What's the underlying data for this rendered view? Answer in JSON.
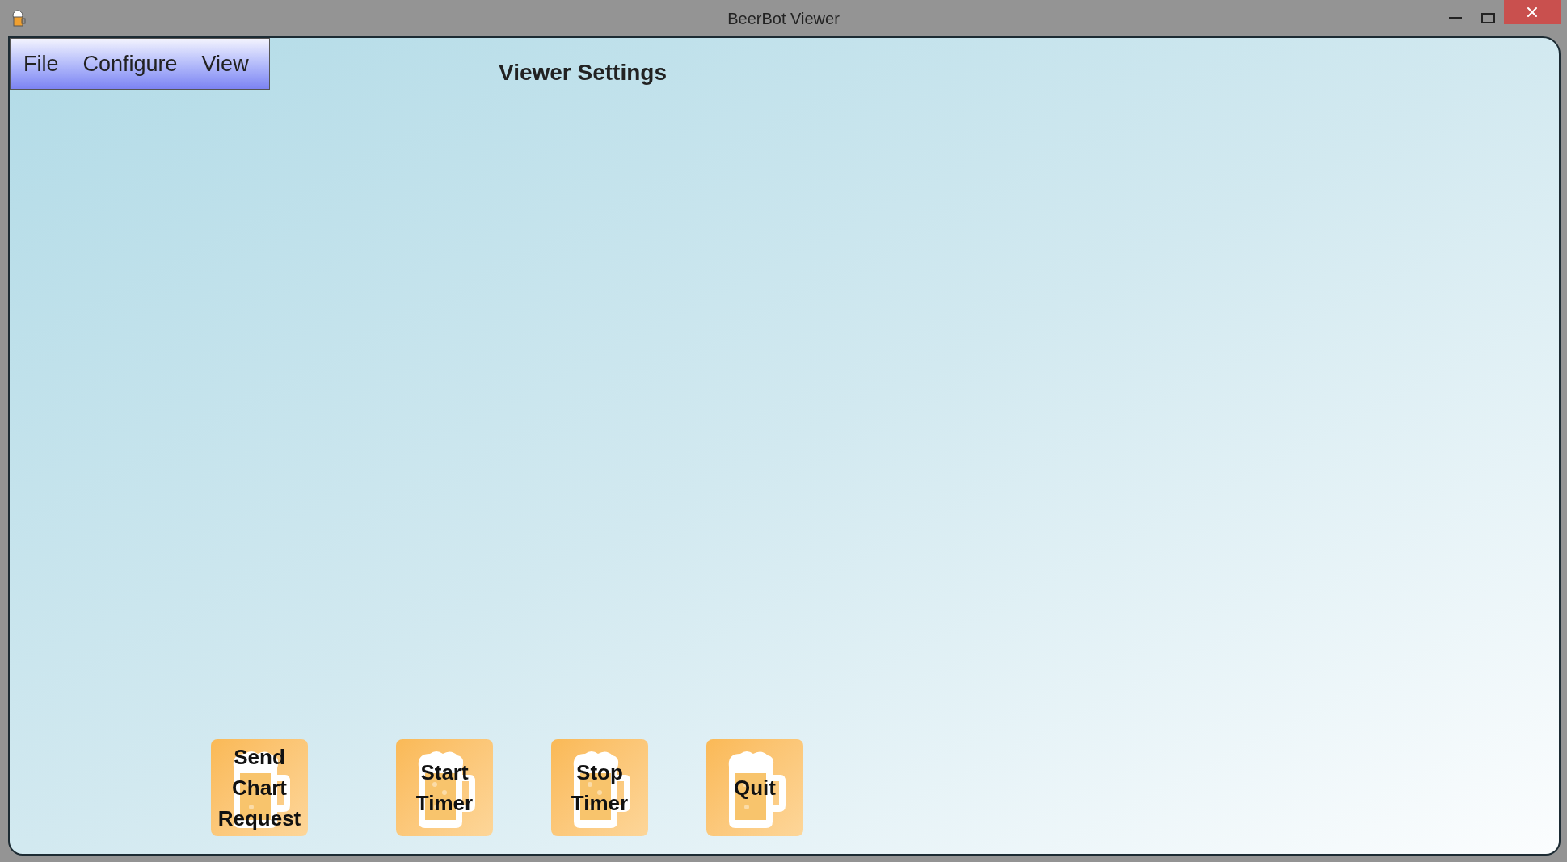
{
  "window": {
    "title": "BeerBot Viewer"
  },
  "menu": [
    {
      "label": "File"
    },
    {
      "label": "Configure"
    },
    {
      "label": "View"
    }
  ],
  "heading": "Viewer Settings",
  "buttons": [
    {
      "label": "Send Chart Request"
    },
    {
      "label": "Start Timer"
    },
    {
      "label": "Stop Timer"
    },
    {
      "label": "Quit"
    }
  ]
}
